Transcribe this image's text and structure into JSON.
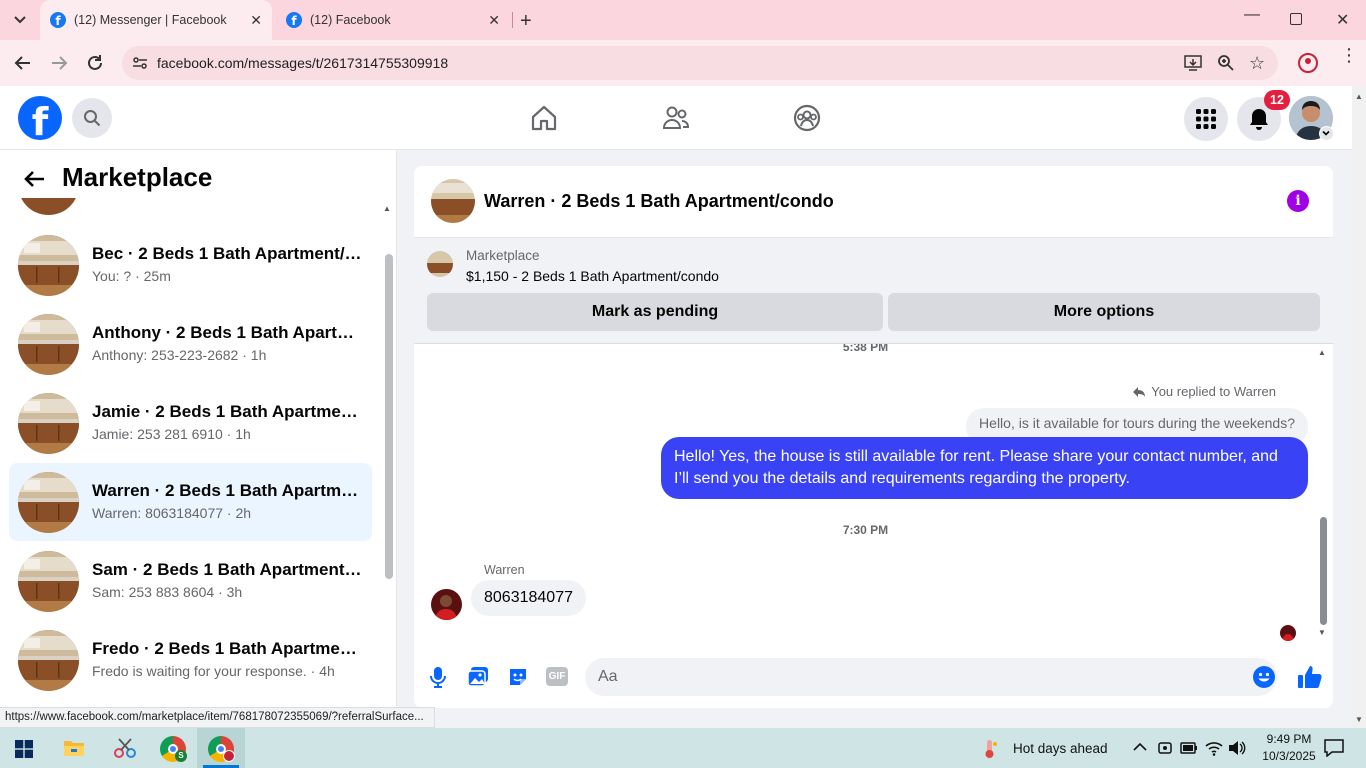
{
  "browser": {
    "tabs": [
      {
        "label": "(12) Messenger | Facebook",
        "active": true
      },
      {
        "label": "(12) Facebook",
        "active": false
      }
    ],
    "url": "facebook.com/messages/t/2617314755309918",
    "status_url": "https://www.facebook.com/marketplace/item/768178072355069/?referralSurface..."
  },
  "header": {
    "logo_letter": "f",
    "notification_count": "12"
  },
  "sidebar": {
    "title": "Marketplace",
    "threads": [
      {
        "title": "Bec · 2 Beds 1 Bath Apartment/c...",
        "preview": "You: ? · 25m",
        "selected": false
      },
      {
        "title": "Anthony · 2 Beds 1 Bath Apartm...",
        "preview": "Anthony: 253-223-2682 · 1h",
        "selected": false
      },
      {
        "title": "Jamie · 2 Beds 1 Bath Apartment...",
        "preview": "Jamie: 253 281 6910 · 1h",
        "selected": false
      },
      {
        "title": "Warren · 2 Beds 1 Bath Apartme...",
        "preview": "Warren: 8063184077 · 2h",
        "selected": true
      },
      {
        "title": "Sam · 2 Beds 1 Bath Apartment/...",
        "preview": "Sam: 253 883 8604 · 3h",
        "selected": false
      },
      {
        "title": "Fredo · 2 Beds 1 Bath Apartment...",
        "preview": "Fredo is waiting for your response. · 4h",
        "selected": false
      }
    ]
  },
  "chat": {
    "title": "Warren · 2 Beds 1 Bath Apartment/condo",
    "listing_label": "Marketplace",
    "listing_detail": "$1,150 - 2 Beds 1 Bath Apartment/condo",
    "mark_pending_label": "Mark as pending",
    "more_options_label": "More options",
    "time1": "5:38 PM",
    "replied_label": "You replied to Warren",
    "quoted_message": "Hello, is it available for tours during the weekends?",
    "my_message": "Hello! Yes, the house is still available for rent. Please share your contact number, and I’ll send you the details and requirements regarding the property.",
    "time2": "7:30 PM",
    "sender_name": "Warren",
    "their_message": "8063184077",
    "composer_placeholder": "Aa",
    "gif_label": "GIF"
  },
  "taskbar": {
    "weather": "Hot days ahead",
    "time": "9:49 PM",
    "date": "10/3/2025"
  },
  "colors": {
    "accent": "#0866ff",
    "bubble_blue": "#3942f5",
    "badge_red": "#e41e3f",
    "info_purple": "#a100e6",
    "tabbar_pink": "#fbd6de"
  }
}
